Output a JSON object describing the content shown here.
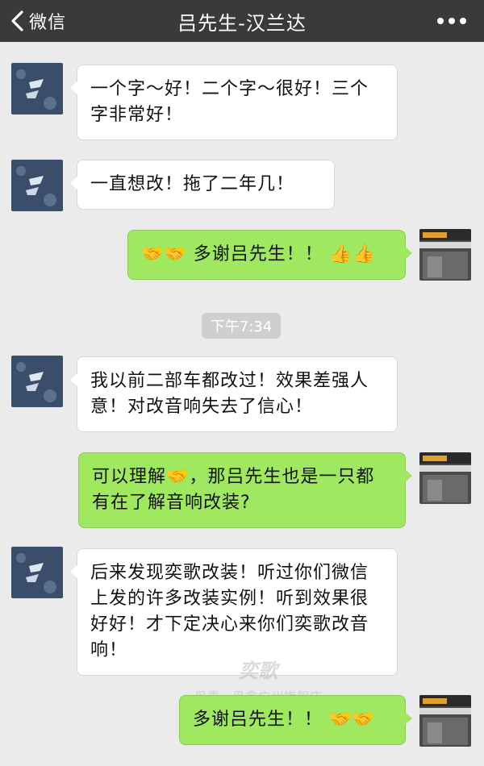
{
  "header": {
    "back_label": "微信",
    "title": "吕先生-汉兰达",
    "more_icon": "more-dots-icon"
  },
  "messages": [
    {
      "side": "in",
      "text": "一个字～好！二个字～很好！三个字非常好！"
    },
    {
      "side": "in",
      "text": "一直想改！拖了二年几！"
    },
    {
      "side": "out",
      "text": "多谢吕先生！！",
      "emoji_before": "🤝🤝",
      "emoji_after": "👍👍"
    },
    {
      "side": "in",
      "text": "我以前二部车都改过！效果差强人意！对改音响失去了信心！"
    },
    {
      "side": "out",
      "text_part1": "可以理解",
      "emoji_mid": "🤝",
      "text_part2": "，那吕先生也是一只都有在了解音响改装?"
    },
    {
      "side": "in",
      "text": "后来发现奕歌改装！听过你们微信上发的许多改装实例！听到效果很好好！才下定决心来你们奕歌改音响！"
    },
    {
      "side": "out",
      "text": "多谢吕先生！！",
      "emoji_after": "🤝🤝"
    }
  ],
  "timestamp": "下午7:34",
  "watermark": {
    "brand": "奕歌",
    "line": "丹麦 · 丹拿广州旗舰店"
  },
  "colors": {
    "header_bg": "#3a3a3c",
    "background": "#ebebeb",
    "outgoing_bubble": "#9fe85f",
    "incoming_bubble": "#ffffff"
  }
}
